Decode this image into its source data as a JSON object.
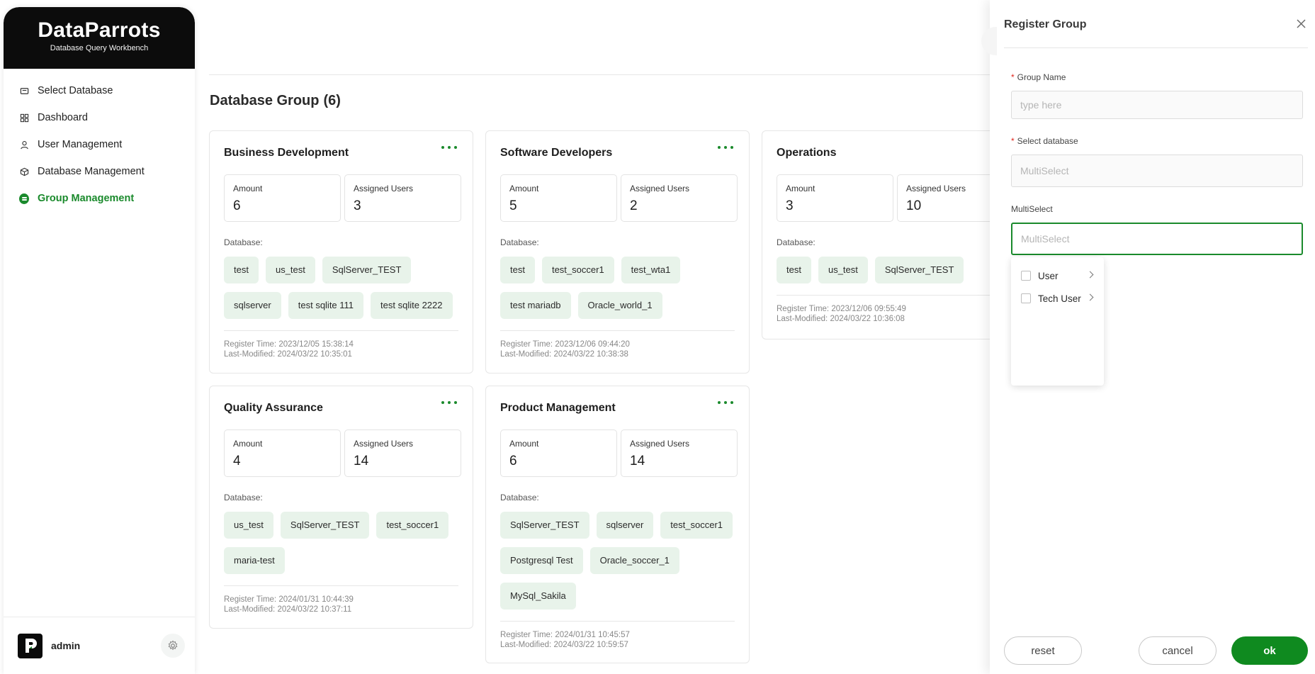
{
  "brand": {
    "name": "DataParrots",
    "subtitle": "Database Query Workbench"
  },
  "sidebar": {
    "items": [
      {
        "label": "Select Database",
        "icon": "select-database-icon",
        "active": false
      },
      {
        "label": "Dashboard",
        "icon": "dashboard-icon",
        "active": false
      },
      {
        "label": "User Management",
        "icon": "user-icon",
        "active": false
      },
      {
        "label": "Database Management",
        "icon": "cube-icon",
        "active": false
      },
      {
        "label": "Group Management",
        "icon": "group-icon",
        "active": true
      }
    ],
    "user": {
      "name": "admin"
    }
  },
  "page": {
    "title": "Database Group",
    "count": "(6)"
  },
  "labels": {
    "amount": "Amount",
    "assigned_users": "Assigned Users",
    "database": "Database:",
    "register_time": "Register Time:",
    "last_modified": "Last-Modified:"
  },
  "groups": [
    {
      "name": "Business Development",
      "amount": "6",
      "assigned_users": "3",
      "databases": [
        "test",
        "us_test",
        "SqlServer_TEST",
        "sqlserver",
        "test sqlite 111",
        "test sqlite 2222"
      ],
      "register_time": "2023/12/05 15:38:14",
      "last_modified": "2024/03/22 10:35:01"
    },
    {
      "name": "Software Developers",
      "amount": "5",
      "assigned_users": "2",
      "databases": [
        "test",
        "test_soccer1",
        "test_wta1",
        "test mariadb",
        "Oracle_world_1"
      ],
      "register_time": "2023/12/06 09:44:20",
      "last_modified": "2024/03/22 10:38:38"
    },
    {
      "name": "Operations",
      "amount": "3",
      "assigned_users": "10",
      "databases": [
        "test",
        "us_test",
        "SqlServer_TEST"
      ],
      "register_time": "2023/12/06 09:55:49",
      "last_modified": "2024/03/22 10:36:08"
    },
    {
      "name": "Quality Assurance",
      "amount": "4",
      "assigned_users": "14",
      "databases": [
        "us_test",
        "SqlServer_TEST",
        "test_soccer1",
        "maria-test"
      ],
      "register_time": "2024/01/31 10:44:39",
      "last_modified": "2024/03/22 10:37:11"
    },
    {
      "name": "Product Management",
      "amount": "6",
      "assigned_users": "14",
      "databases": [
        "SqlServer_TEST",
        "sqlserver",
        "test_soccer1",
        "Postgresql Test",
        "Oracle_soccer_1",
        "MySql_Sakila"
      ],
      "register_time": "2024/01/31 10:45:57",
      "last_modified": "2024/03/22 10:59:57"
    }
  ],
  "drawer": {
    "title": "Register Group",
    "group_name_label": "Group Name",
    "group_name_placeholder": "type  here",
    "select_db_label": "Select database",
    "select_db_placeholder": "MultiSelect",
    "multiselect_label": "MultiSelect",
    "multiselect_placeholder": "MultiSelect",
    "dropdown_options": [
      "User",
      "Tech User"
    ],
    "buttons": {
      "reset": "reset",
      "cancel": "cancel",
      "ok": "ok"
    }
  },
  "colors": {
    "accent": "#1a8a2c",
    "primary_button": "#0f8a1f",
    "tag_bg": "#e8f3ea",
    "required": "#e0251c"
  }
}
